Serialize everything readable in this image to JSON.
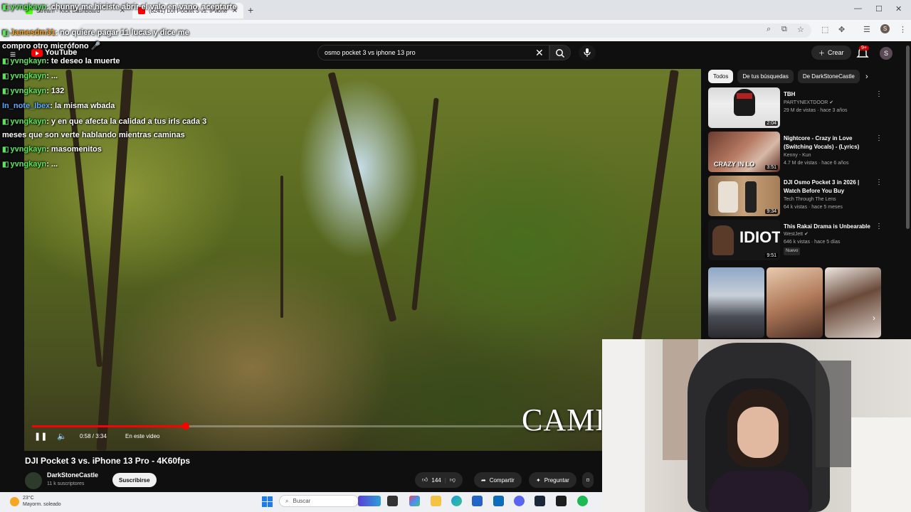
{
  "browser": {
    "tabs": [
      {
        "label": "Stream - Kick Dashboard",
        "color": "#53fc18"
      },
      {
        "label": "(8241) DJI Pocket 3 vs. iPhone 13 Pro",
        "color": "#ff0000"
      }
    ],
    "new_tab": "+",
    "profile_initial": "S"
  },
  "youtube": {
    "logo": "YouTube",
    "search_query": "osmo pocket 3 vs iphone 13 pro",
    "create_label": "Crear",
    "notification_count": "9+",
    "avatar_initial": "S"
  },
  "chat": [
    {
      "user": "yvngkayn",
      "text": ": chunny me hiciste abrir el valo en vano, aceptarte",
      "color": "#5ce65c"
    },
    {
      "user": "Jamesdm31",
      "text": ": no quiere pagar 11 lucas y dice me",
      "color": "#f7a21b"
    },
    {
      "user": "",
      "text": "compro otro micrófono 🎤",
      "color": "#ffffff"
    },
    {
      "user": "yvngkayn",
      "text": ": te deseo la muerte",
      "color": "#5ce65c"
    },
    {
      "user": "yvngkayn",
      "text": ": ...",
      "color": "#5ce65c"
    },
    {
      "user": "yvngkayn",
      "text": ": 132",
      "color": "#5ce65c"
    },
    {
      "user": "In_note_Ibex",
      "text": ": la misma wbada",
      "color": "#5aa8ff"
    },
    {
      "user": "yvngkayn",
      "text": ": y en que afecta la calidad a tus irls cada 3 meses que son verte hablando mientras caminas",
      "color": "#5ce65c"
    },
    {
      "user": "yvngkayn",
      "text": ": masomenitos",
      "color": "#5ce65c"
    },
    {
      "user": "yvngkayn",
      "text": ": ...",
      "color": "#5ce65c"
    }
  ],
  "player": {
    "overlay_text": "CAMERA",
    "time": "0:58 / 3:34",
    "chapter": "En este video",
    "progress": 0.27
  },
  "video": {
    "title": "DJI Pocket 3 vs. iPhone 13 Pro - 4K60fps",
    "channel": "DarkStoneCastle",
    "subscribers": "11 k suscriptores",
    "subscribe_label": "Suscribirse",
    "likes": "144",
    "share_label": "Compartir",
    "ask_label": "Preguntar"
  },
  "sidebar": {
    "chips": [
      "Todos",
      "De tus búsquedas",
      "De DarkStoneCastle"
    ],
    "recommendations": [
      {
        "title": "TBH",
        "channel": "PARTYNEXTDOOR ✔",
        "meta": "29 M de vistas · hace 3 años",
        "duration": "2:04",
        "badge": ""
      },
      {
        "title": "Nightcore - Crazy in Love (Switching Vocals) - (Lyrics)",
        "channel": "Kenny - Kun",
        "meta": "4.7 M de vistas · hace 6 años",
        "duration": "3:51",
        "badge": ""
      },
      {
        "title": "DJI Osmo Pocket 3 in 2026 | Watch Before You Buy",
        "channel": "Tech Through The Lens",
        "meta": "64 k vistas · hace 5 meses",
        "duration": "9:34",
        "badge": ""
      },
      {
        "title": "This Rakai Drama is Unbearable",
        "channel": "WestJett ✔",
        "meta": "646 k vistas · hace 5 días",
        "duration": "9:51",
        "badge": "Nuevo"
      }
    ]
  },
  "taskbar": {
    "temp": "23°C",
    "condition": "Mayorm. soleado",
    "search_placeholder": "Buscar"
  },
  "colors": {
    "accent": "#ff0000",
    "kick": "#53fc18"
  }
}
